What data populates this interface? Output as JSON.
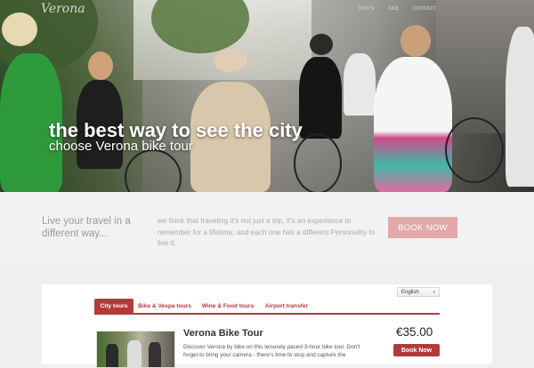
{
  "brand": "Verona",
  "topnav": [
    "tours",
    "faq",
    "contact"
  ],
  "hero": {
    "title": "the best way to see the city",
    "subtitle": "choose Verona bike tour"
  },
  "band": {
    "tagline": "Live your travel in a different way...",
    "description": "we think that traveling it's not just a trip, it's an experience to remember for a lifetime, and each one has a different Personality to live it.",
    "cta": "BOOK NOW"
  },
  "language": {
    "selected": "English"
  },
  "tabs": [
    {
      "label": "City tours",
      "active": true
    },
    {
      "label": "Bike & Vespa tours",
      "active": false
    },
    {
      "label": "Wine & Food tours",
      "active": false
    },
    {
      "label": "Airport transfer",
      "active": false
    }
  ],
  "tour": {
    "title": "Verona Bike Tour",
    "description": "Discover Verona by bike on this leisurely paced 3-hour bike tour. Don't forget to bring your camera - there's time to stop and capture the",
    "price": "€35.00",
    "button": "Book Now"
  },
  "colors": {
    "accent": "#b33a3a",
    "cta_soft": "#e2a9a9"
  }
}
